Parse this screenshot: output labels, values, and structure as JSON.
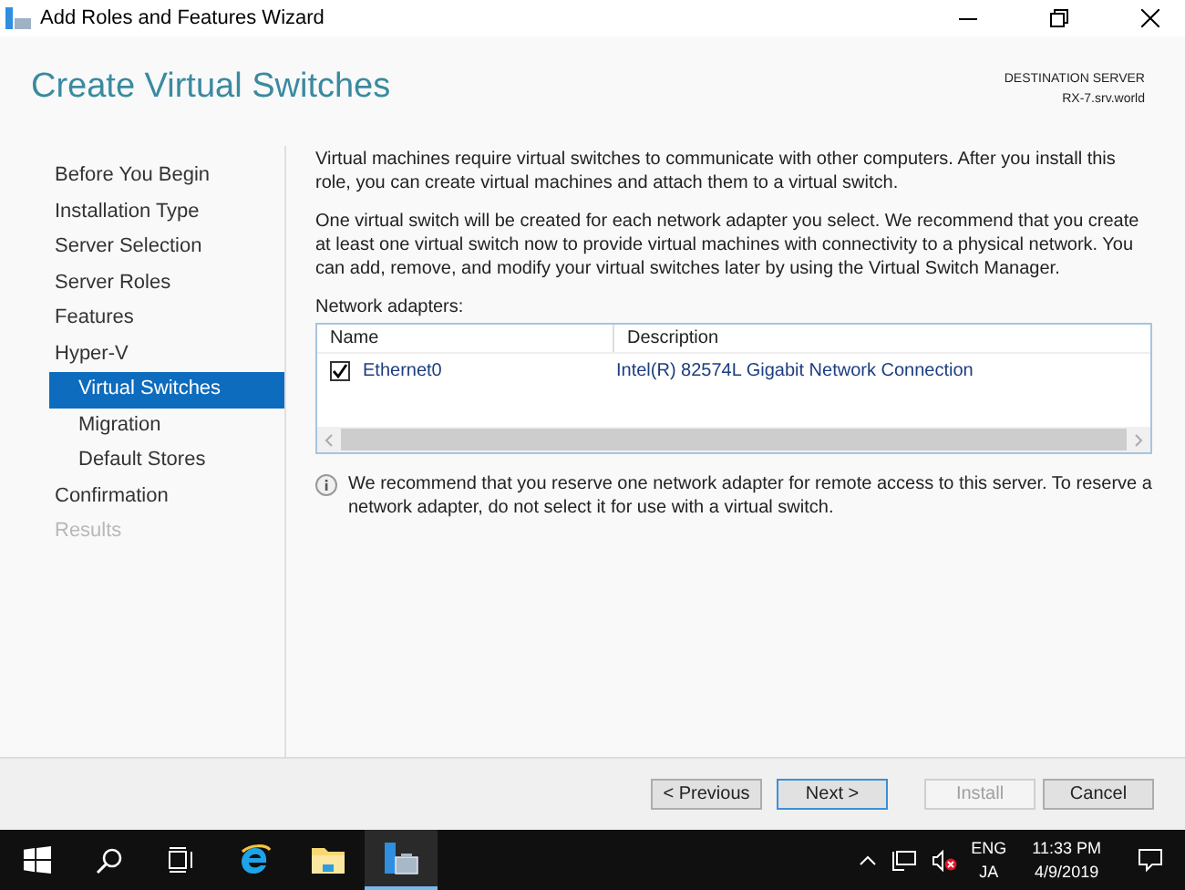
{
  "window": {
    "title": "Add Roles and Features Wizard"
  },
  "header": {
    "title": "Create Virtual Switches",
    "destination_label": "DESTINATION SERVER",
    "destination_server": "RX-7.srv.world"
  },
  "nav": [
    {
      "label": "Before You Begin",
      "selected": false,
      "disabled": false
    },
    {
      "label": "Installation Type",
      "selected": false,
      "disabled": false
    },
    {
      "label": "Server Selection",
      "selected": false,
      "disabled": false
    },
    {
      "label": "Server Roles",
      "selected": false,
      "disabled": false
    },
    {
      "label": "Features",
      "selected": false,
      "disabled": false
    },
    {
      "label": "Hyper-V",
      "selected": false,
      "disabled": false,
      "children": [
        {
          "label": "Virtual Switches",
          "selected": true,
          "disabled": false
        },
        {
          "label": "Migration",
          "selected": false,
          "disabled": false
        },
        {
          "label": "Default Stores",
          "selected": false,
          "disabled": false
        }
      ]
    },
    {
      "label": "Confirmation",
      "selected": false,
      "disabled": false
    },
    {
      "label": "Results",
      "selected": false,
      "disabled": true
    }
  ],
  "paragraphs": [
    "Virtual machines require virtual switches to communicate with other computers. After you install this role, you can create virtual machines and attach them to a virtual switch.",
    "One virtual switch will be created for each network adapter you select. We recommend that you create at least one virtual switch now to provide virtual machines with connectivity to a physical network. You can add, remove, and modify your virtual switches later by using the Virtual Switch Manager."
  ],
  "adapters": {
    "label": "Network adapters:",
    "columns": [
      "Name",
      "Description"
    ],
    "rows": [
      {
        "name": "Ethernet0",
        "description": "Intel(R) 82574L Gigabit Network Connection",
        "checked": true
      }
    ]
  },
  "note": "We recommend that you reserve one network adapter for remote access to this server. To reserve a network adapter, do not select it for use with a virtual switch.",
  "buttons": [
    {
      "label": "< Previous",
      "disabled": false,
      "default": false
    },
    {
      "label": "Next >",
      "disabled": false,
      "default": true
    },
    {
      "label": "Install",
      "disabled": true,
      "default": false
    },
    {
      "label": "Cancel",
      "disabled": false,
      "default": false
    }
  ],
  "taskbar": {
    "apps": [
      {
        "kind": "start",
        "selected": false
      },
      {
        "kind": "search",
        "selected": false
      },
      {
        "kind": "taskview",
        "selected": false
      },
      {
        "kind": "browser",
        "selected": false
      },
      {
        "kind": "folder",
        "selected": false
      },
      {
        "kind": "server",
        "selected": true
      }
    ],
    "input_lang": [
      "ENG",
      "JA"
    ],
    "time": "11:33 PM",
    "date": "4/9/2019"
  }
}
